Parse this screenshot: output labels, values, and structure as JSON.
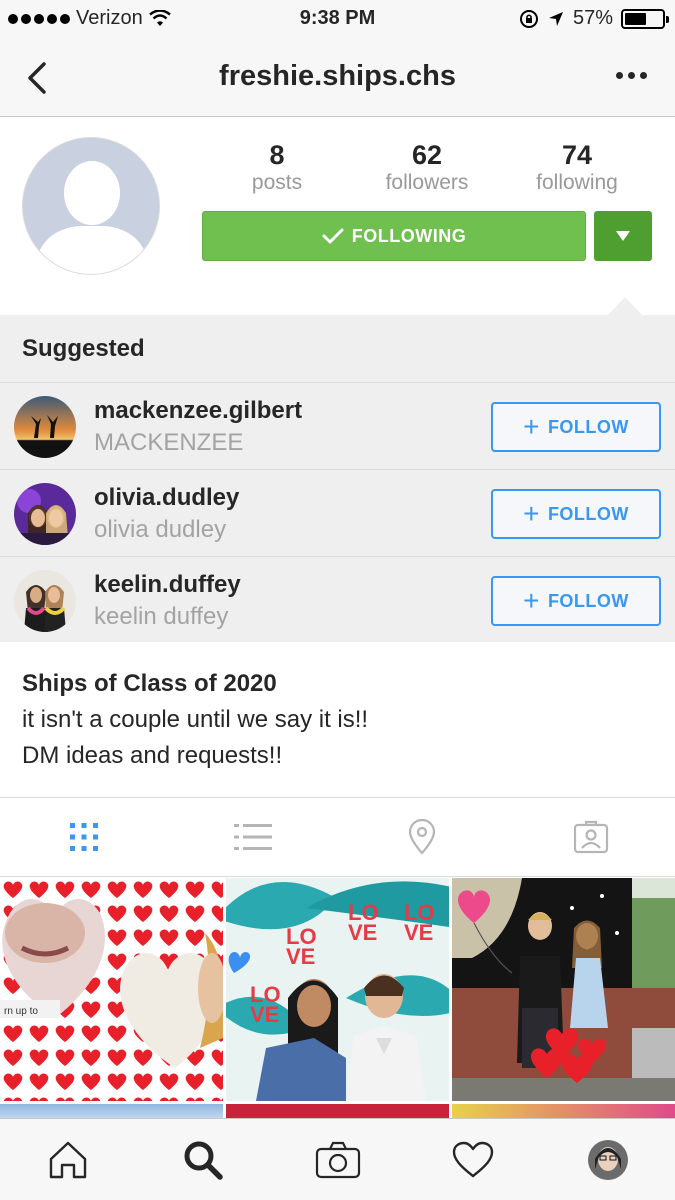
{
  "status_bar": {
    "carrier": "Verizon",
    "time": "9:38 PM",
    "battery": "57%",
    "battery_level": 0.57
  },
  "nav": {
    "title": "freshie.ships.chs"
  },
  "profile": {
    "stats": [
      {
        "value": "8",
        "label": "posts"
      },
      {
        "value": "62",
        "label": "followers"
      },
      {
        "value": "74",
        "label": "following"
      }
    ],
    "following_button": "FOLLOWING"
  },
  "suggested": {
    "heading": "Suggested",
    "items": [
      {
        "username": "mackenzee.gilbert",
        "full_name": "MACKENZEE",
        "button": "FOLLOW"
      },
      {
        "username": "olivia.dudley",
        "full_name": "olivia dudley",
        "button": "FOLLOW"
      },
      {
        "username": "keelin.duffey",
        "full_name": "keelin duffey",
        "button": "FOLLOW"
      }
    ]
  },
  "bio": {
    "name": "Ships of Class of 2020",
    "line1": "it isn't a couple until we say it is!!",
    "line2": "DM ideas and requests!!"
  },
  "grid": {
    "tile1_caption": "rn up to"
  },
  "colors": {
    "following_green": "#70c050",
    "dropdown_green": "#4f9e30",
    "follow_blue": "#3897f0"
  }
}
